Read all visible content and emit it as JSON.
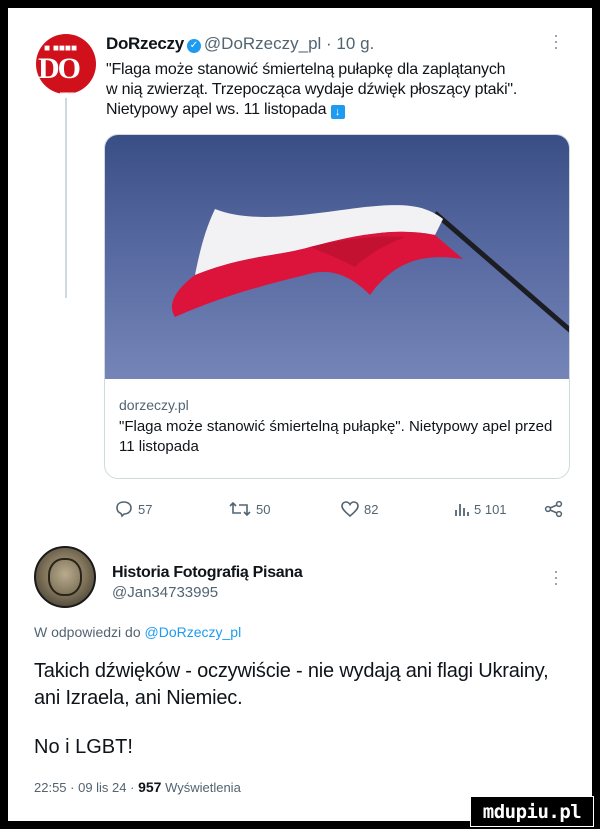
{
  "tweet1": {
    "avatar_small": "■ ■■■■",
    "avatar_logo": "DO RZE",
    "name": "DoRzeczy",
    "handle": "@DoRzeczy_pl",
    "time": "· 10 g.",
    "text_line1": "\"Flaga może stanowić śmiertelną pułapkę dla zaplątanych",
    "text_line2": "w nią zwierząt. Trzepocząca wydaje dźwięk płoszący ptaki\".",
    "text_line3": "Nietypowy apel ws. 11 listopada",
    "card": {
      "domain": "dorzeczy.pl",
      "title": "\"Flaga może stanowić śmiertelną pułapkę\". Nietypowy apel przed 11 listopada"
    },
    "actions": {
      "replies": "57",
      "retweets": "50",
      "likes": "82",
      "views": "5 101"
    }
  },
  "tweet2": {
    "name": "Historia Fotografią Pisana",
    "handle": "@Jan34733995",
    "reply_prefix": "W odpowiedzi do",
    "reply_mention": "@DoRzeczy_pl",
    "text": "Takich dźwięków - oczywiście - nie wydają ani flagi Ukrainy, ani Izraela, ani Niemiec.",
    "text2": "No i LGBT!",
    "meta_time": "22:55 · 09 lis 24 ·",
    "meta_views": "957",
    "meta_views_label": "Wyświetlenia"
  },
  "watermark": "mdupiu.pl",
  "colors": {
    "accent": "#1d9bf0",
    "avatar_red": "#d0101b",
    "flag_red": "#dc143c"
  }
}
